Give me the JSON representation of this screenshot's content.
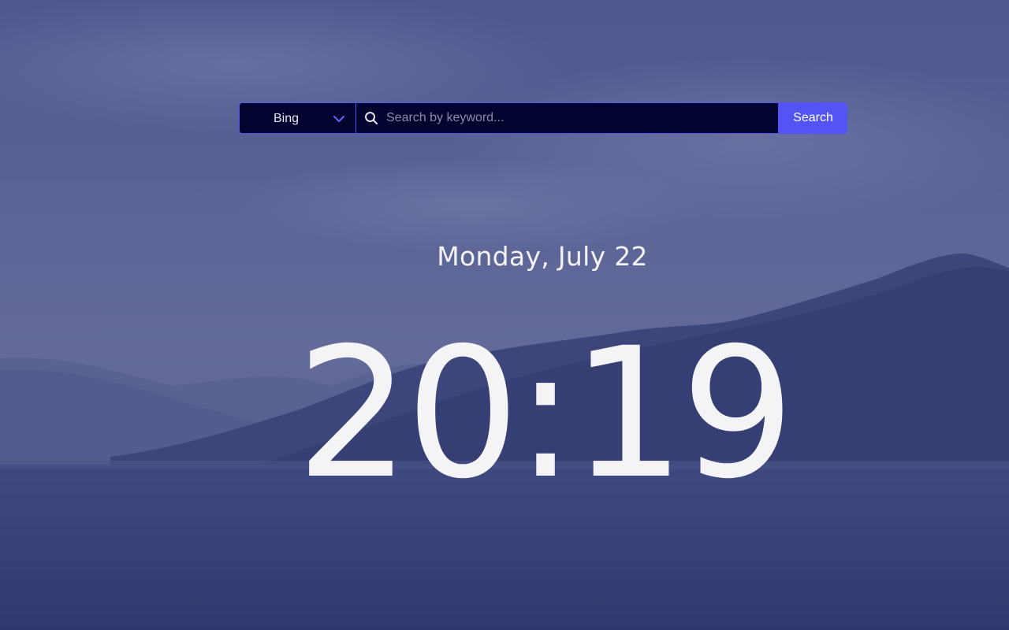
{
  "search": {
    "engine": "Bing",
    "placeholder": "Search by keyword...",
    "value": "",
    "button_label": "Search"
  },
  "clock": {
    "date": "Monday, July 22",
    "time": "20:19"
  },
  "colors": {
    "accent": "#5454f5",
    "search_bg": "#03032f",
    "text": "#f4f4f6"
  },
  "icons": {
    "search": "search-icon",
    "dropdown": "chevron-down-icon"
  }
}
